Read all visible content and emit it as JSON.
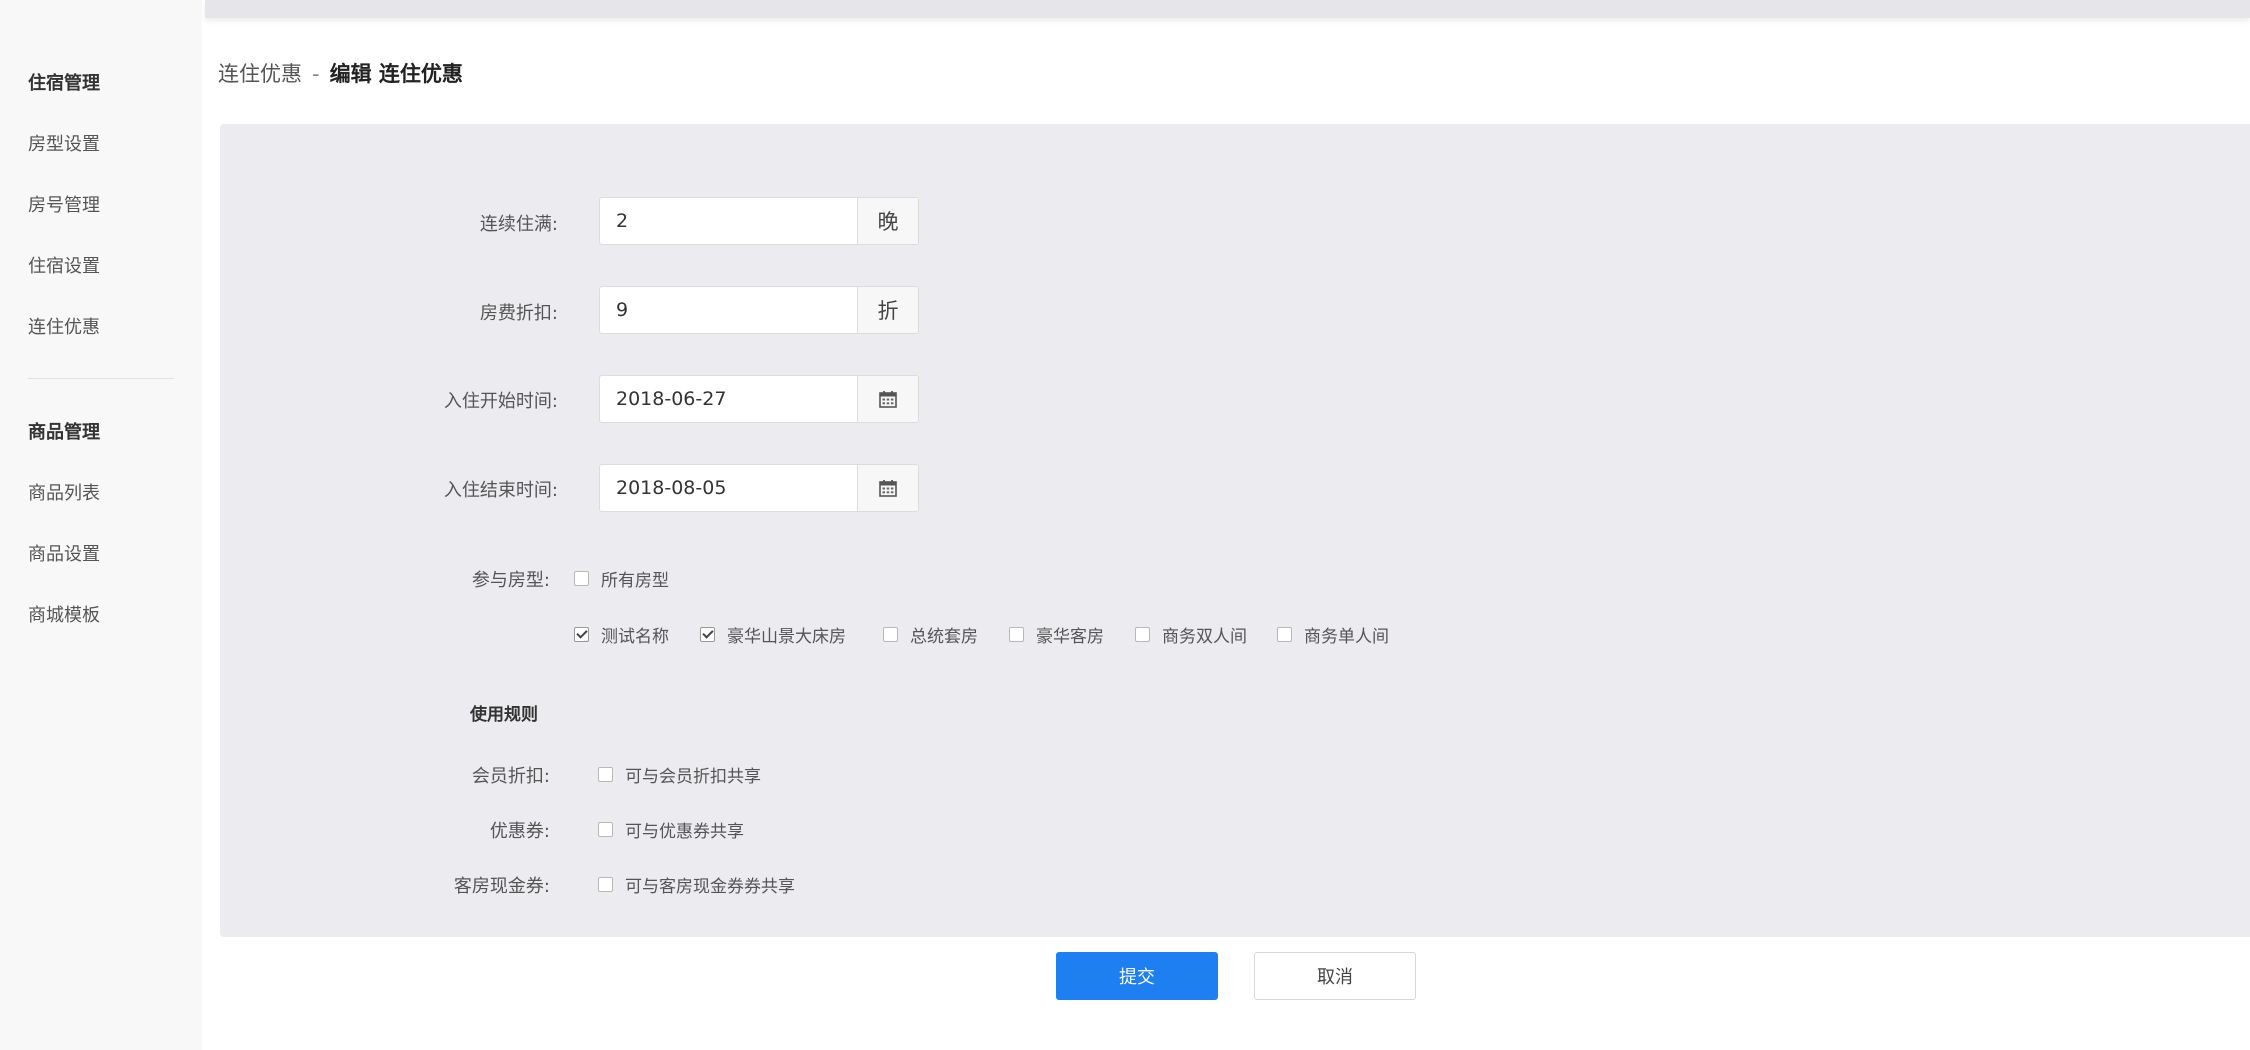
{
  "sidebar": {
    "groups": [
      {
        "title": "住宿管理",
        "items": [
          "房型设置",
          "房号管理",
          "住宿设置",
          "连住优惠"
        ]
      },
      {
        "title": "商品管理",
        "items": [
          "商品列表",
          "商品设置",
          "商城模板"
        ]
      }
    ]
  },
  "breadcrumb": {
    "parent": "连住优惠",
    "separator": "-",
    "current": "编辑 连住优惠"
  },
  "form": {
    "consecutive_nights": {
      "label": "连续住满:",
      "value": "2",
      "unit": "晚"
    },
    "room_discount": {
      "label": "房费折扣:",
      "value": "9",
      "unit": "折"
    },
    "checkin_start": {
      "label": "入住开始时间:",
      "value": "2018-06-27",
      "icon": "calendar-icon"
    },
    "checkin_end": {
      "label": "入住结束时间:",
      "value": "2018-08-05",
      "icon": "calendar-icon"
    },
    "room_types": {
      "label": "参与房型:",
      "all": {
        "label": "所有房型",
        "checked": false
      },
      "options": [
        {
          "label": "测试名称",
          "checked": true
        },
        {
          "label": "豪华山景大床房",
          "checked": true
        },
        {
          "label": "总统套房",
          "checked": false
        },
        {
          "label": "豪华客房",
          "checked": false
        },
        {
          "label": "商务双人间",
          "checked": false
        },
        {
          "label": "商务单人间",
          "checked": false
        }
      ]
    },
    "rules": {
      "title": "使用规则",
      "member_discount": {
        "label": "会员折扣:",
        "option": "可与会员折扣共享",
        "checked": false
      },
      "coupon": {
        "label": "优惠券:",
        "option": "可与优惠券共享",
        "checked": false
      },
      "room_voucher": {
        "label": "客房现金券:",
        "option": "可与客房现金券券共享",
        "checked": false
      }
    }
  },
  "actions": {
    "submit": "提交",
    "cancel": "取消"
  },
  "colors": {
    "primary": "#1e7ff0",
    "panel_bg": "#ececf0"
  }
}
